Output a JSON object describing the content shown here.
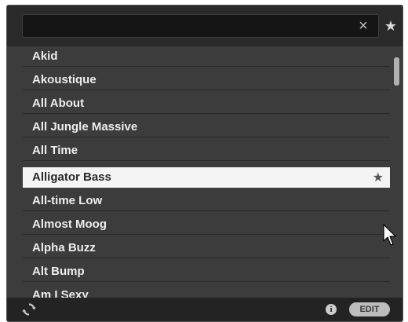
{
  "search": {
    "value": "",
    "placeholder": "",
    "clear_symbol": "×"
  },
  "favorites_filter_symbol": "★",
  "list": {
    "items": [
      {
        "label": "Akid"
      },
      {
        "label": "Akoustique"
      },
      {
        "label": "All About"
      },
      {
        "label": "All Jungle Massive"
      },
      {
        "label": "All Time"
      },
      {
        "label": "Alligator Bass",
        "selected": true,
        "favorite_symbol": "★"
      },
      {
        "label": "All-time Low"
      },
      {
        "label": "Almost Moog"
      },
      {
        "label": "Alpha Buzz"
      },
      {
        "label": "Alt Bump"
      },
      {
        "label": "Am I Sexy"
      }
    ]
  },
  "footer": {
    "info_symbol": "i",
    "edit_label": "EDIT"
  },
  "icons": {
    "refresh": "refresh-icon",
    "info": "info-icon",
    "favorite": "star-icon",
    "clear": "close-icon"
  },
  "colors": {
    "panel_bg": "#2e2e2e",
    "list_bg": "#3c3c3c",
    "selected_bg": "#f4f4f4",
    "text": "#eeeeee"
  }
}
